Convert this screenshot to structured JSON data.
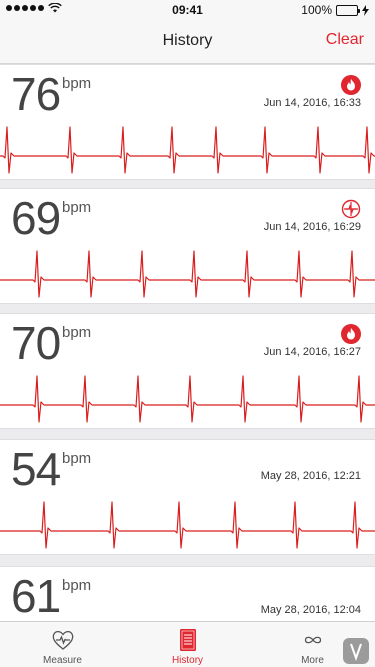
{
  "status": {
    "time": "09:41",
    "battery": "100%"
  },
  "nav": {
    "title": "History",
    "clear_label": "Clear"
  },
  "unit_label": "bpm",
  "colors": {
    "accent": "#e0262f",
    "ecg": "#d81e1e"
  },
  "records": [
    {
      "bpm": "76",
      "date": "Jun 14, 2016, 16:33",
      "icon": "flame-icon",
      "beats": [
        0.02,
        0.19,
        0.33,
        0.46,
        0.58,
        0.71,
        0.85,
        0.98
      ]
    },
    {
      "bpm": "69",
      "date": "Jun 14, 2016, 16:29",
      "icon": "crosshair-icon",
      "beats": [
        0.1,
        0.24,
        0.38,
        0.52,
        0.66,
        0.8,
        0.94
      ]
    },
    {
      "bpm": "70",
      "date": "Jun 14, 2016, 16:27",
      "icon": "flame-icon",
      "beats": [
        0.1,
        0.23,
        0.37,
        0.51,
        0.65,
        0.8,
        0.96
      ]
    },
    {
      "bpm": "54",
      "date": "May 28, 2016, 12:21",
      "icon": "",
      "beats": [
        0.12,
        0.3,
        0.48,
        0.63,
        0.79,
        0.95
      ]
    },
    {
      "bpm": "61",
      "date": "May 28, 2016, 12:04",
      "icon": "",
      "beats": []
    }
  ],
  "tabs": [
    {
      "label": "Measure",
      "icon": "heart-pulse-icon",
      "active": false
    },
    {
      "label": "History",
      "icon": "book-list-icon",
      "active": true
    },
    {
      "label": "More",
      "icon": "infinity-icon",
      "active": false
    }
  ]
}
